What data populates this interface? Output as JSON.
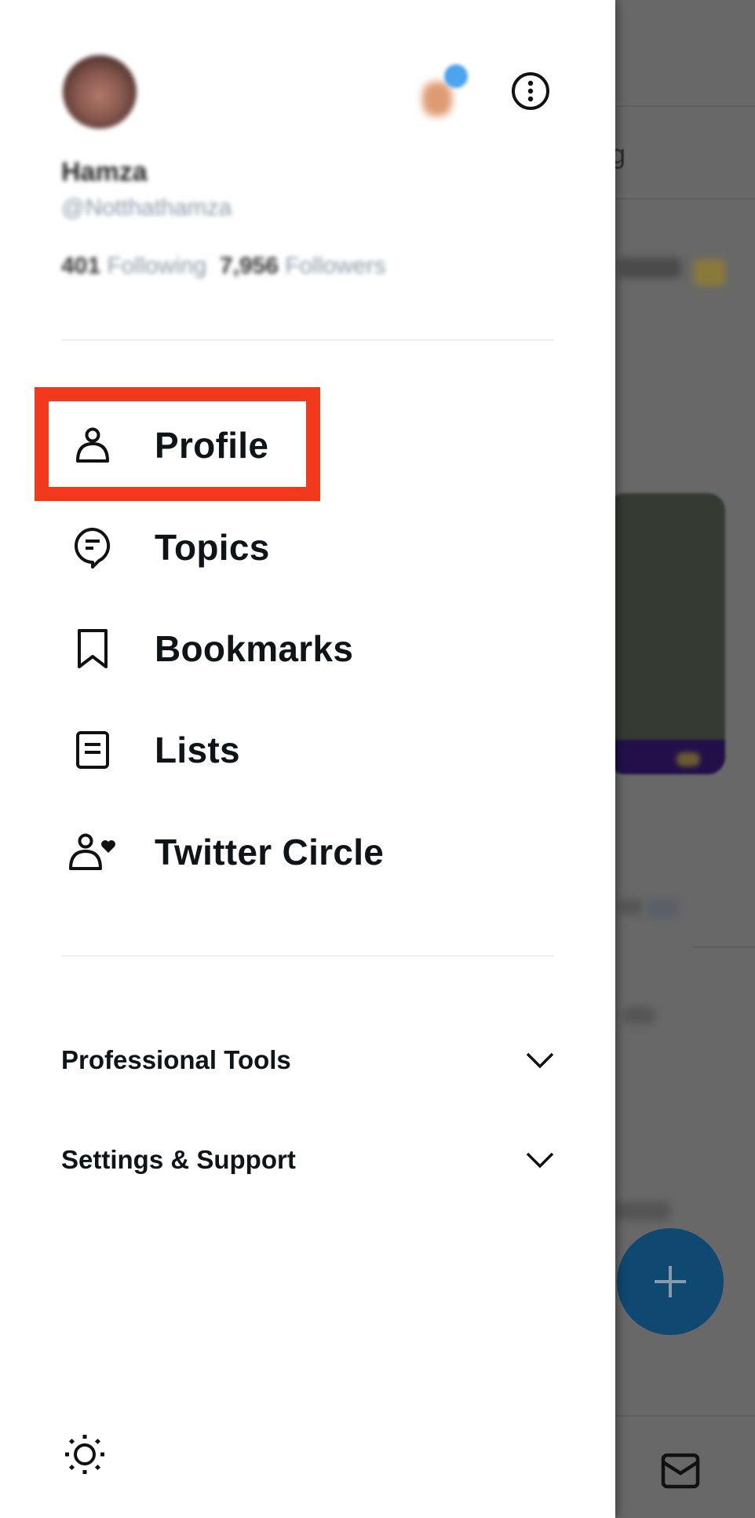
{
  "profile": {
    "name": "Hamza",
    "handle": "@Notthathamza",
    "following_count": "401",
    "following_label": "Following",
    "followers_count": "7,956",
    "followers_label": "Followers"
  },
  "menu": {
    "items": [
      {
        "label": "Profile",
        "icon": "person-icon",
        "highlighted": true
      },
      {
        "label": "Topics",
        "icon": "topics-bubble-icon"
      },
      {
        "label": "Bookmarks",
        "icon": "bookmark-icon"
      },
      {
        "label": "Lists",
        "icon": "list-icon"
      },
      {
        "label": "Twitter Circle",
        "icon": "circle-person-heart-icon"
      }
    ]
  },
  "sections": [
    {
      "label": "Professional Tools",
      "icon": "chevron-down-icon"
    },
    {
      "label": "Settings & Support",
      "icon": "chevron-down-icon"
    }
  ],
  "footer": {
    "theme_icon": "sun-icon"
  },
  "background": {
    "partial_text_1": "g",
    "compose_icon": "plus-icon",
    "nav_icon": "mail-icon"
  },
  "colors": {
    "highlight": "#f2391b",
    "fab": "#0f4870",
    "overlay": "#686868",
    "text": "#0f1419"
  }
}
